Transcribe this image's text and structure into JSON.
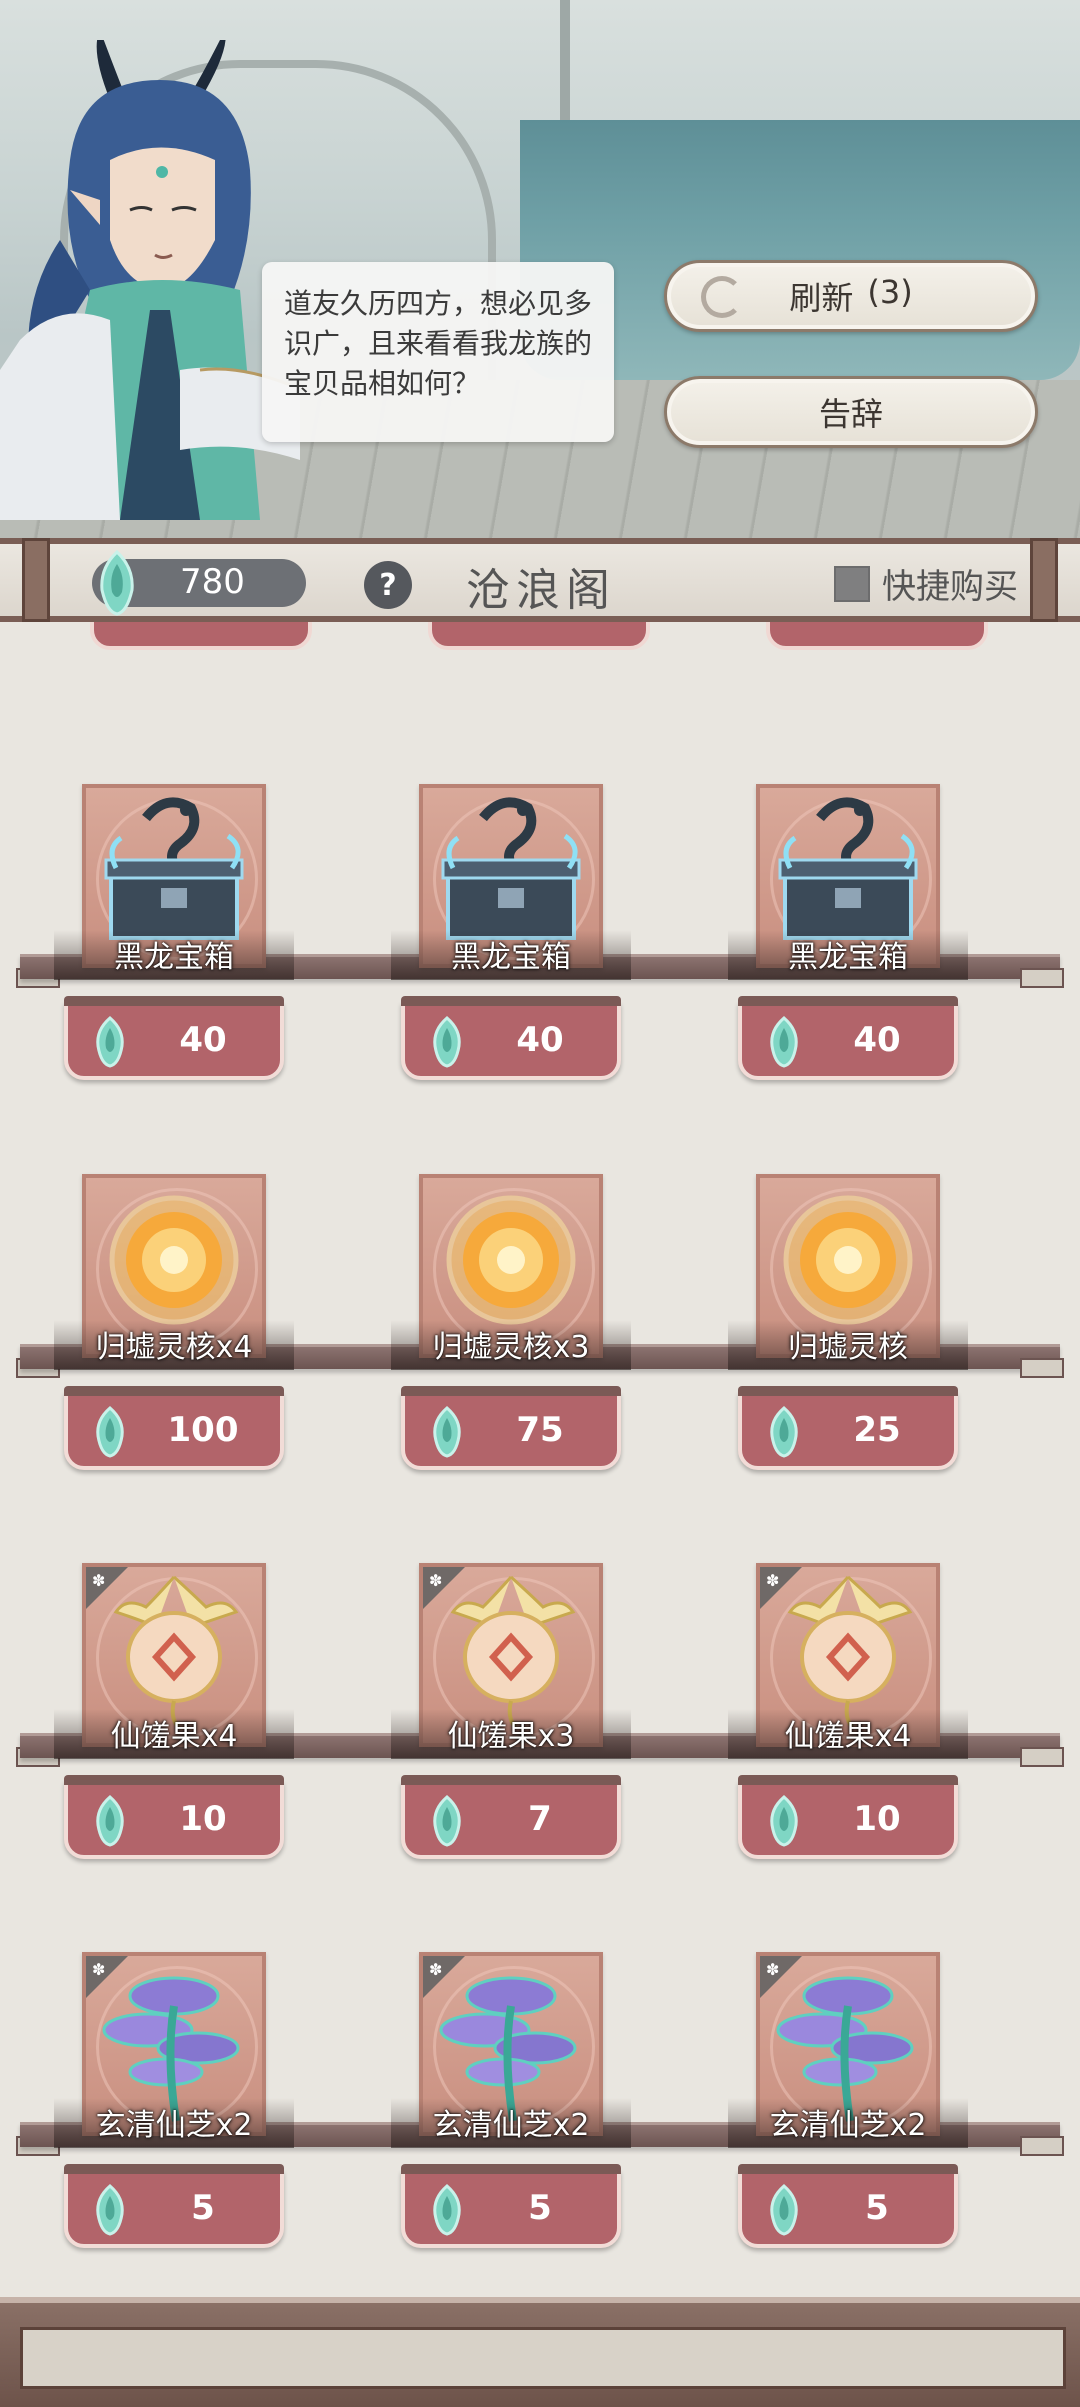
{
  "dialog": {
    "text": "道友久历四方，想必见多识广，且来看看我龙族的宝贝品相如何？"
  },
  "buttons": {
    "refresh_label": "刷新",
    "refresh_count": "(3)",
    "leave_label": "告辞"
  },
  "header": {
    "currency_value": "780",
    "help_label": "?",
    "title": "沧浪阁",
    "quick_buy_label": "快捷购买"
  },
  "rows": [
    {
      "items": [
        {
          "name": "黑龙宝箱",
          "price": "40",
          "icon": "black-dragon-chest-icon",
          "leaf": false
        },
        {
          "name": "黑龙宝箱",
          "price": "40",
          "icon": "black-dragon-chest-icon",
          "leaf": false
        },
        {
          "name": "黑龙宝箱",
          "price": "40",
          "icon": "black-dragon-chest-icon",
          "leaf": false
        }
      ]
    },
    {
      "items": [
        {
          "name": "归墟灵核x4",
          "price": "100",
          "icon": "spirit-core-icon",
          "leaf": false
        },
        {
          "name": "归墟灵核x3",
          "price": "75",
          "icon": "spirit-core-icon",
          "leaf": false
        },
        {
          "name": "归墟灵核",
          "price": "25",
          "icon": "spirit-core-icon",
          "leaf": false
        }
      ]
    },
    {
      "items": [
        {
          "name": "仙馐果x4",
          "price": "10",
          "icon": "immortal-fruit-icon",
          "leaf": true
        },
        {
          "name": "仙馐果x3",
          "price": "7",
          "icon": "immortal-fruit-icon",
          "leaf": true
        },
        {
          "name": "仙馐果x4",
          "price": "10",
          "icon": "immortal-fruit-icon",
          "leaf": true
        }
      ]
    },
    {
      "items": [
        {
          "name": "玄清仙芝x2",
          "price": "5",
          "icon": "mystic-mushroom-icon",
          "leaf": true
        },
        {
          "name": "玄清仙芝x2",
          "price": "5",
          "icon": "mystic-mushroom-icon",
          "leaf": true
        },
        {
          "name": "玄清仙芝x2",
          "price": "5",
          "icon": "mystic-mushroom-icon",
          "leaf": true
        }
      ]
    }
  ],
  "colors": {
    "price_tag": "#b2646a",
    "card": "#d9a99a",
    "gem": "#7fd6c4"
  }
}
